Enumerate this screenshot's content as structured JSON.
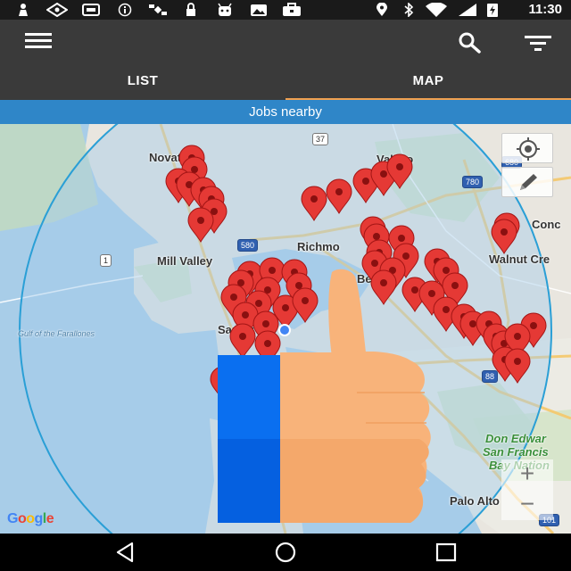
{
  "status_bar": {
    "time": "11:30",
    "icons": [
      "person-icon",
      "vpn-icon",
      "sim-icon",
      "info-icon",
      "satellite-icon",
      "lock-icon",
      "android-icon",
      "image-icon",
      "briefcase-icon",
      "location-icon",
      "bluetooth-icon",
      "wifi-icon",
      "data-icon",
      "battery-icon"
    ]
  },
  "app_bar": {
    "menu_icon": "hamburger-menu-icon",
    "search_icon": "search-icon",
    "filter_icon": "filter-icon"
  },
  "tabs": [
    {
      "label": "LIST",
      "selected": false
    },
    {
      "label": "MAP",
      "selected": true
    }
  ],
  "banner": {
    "text": "Jobs nearby"
  },
  "map": {
    "places": {
      "novato": "Novato",
      "vallejo": "Vallejo",
      "concord": "Conc",
      "mill_valley": "Mill Valley",
      "richmond": "Richmo",
      "walnut_creek": "Walnut Cre",
      "berkeley": "Be",
      "san_francisco": "San Fr",
      "gulf": "Gulf of the Farallones",
      "don_edwards_1": "Don Edwar",
      "don_edwards_2": "San Francis",
      "don_edwards_3": "Bay Nation",
      "palo_alto": "Palo Alto"
    },
    "shields": {
      "hwy37": "37",
      "hwy680": "680",
      "hwy780": "780",
      "hwy580": "580",
      "hwy1": "1",
      "hwy880": "88",
      "hwy101": "101"
    },
    "controls": {
      "locate_icon": "my-location-icon",
      "draw_icon": "pencil-icon",
      "zoom_in": "+",
      "zoom_out": "−"
    },
    "attribution": "Google",
    "marker_color": "#e53935",
    "radius_color": "#2a9fd6"
  },
  "overlay": {
    "thumbs_up_icon": "thumbs-up-icon",
    "skin_color": "#f8b37a",
    "cuff_color": "#0a6ff0"
  },
  "nav_bar": {
    "back_icon": "back-icon",
    "home_icon": "home-icon",
    "recents_icon": "recents-icon"
  }
}
